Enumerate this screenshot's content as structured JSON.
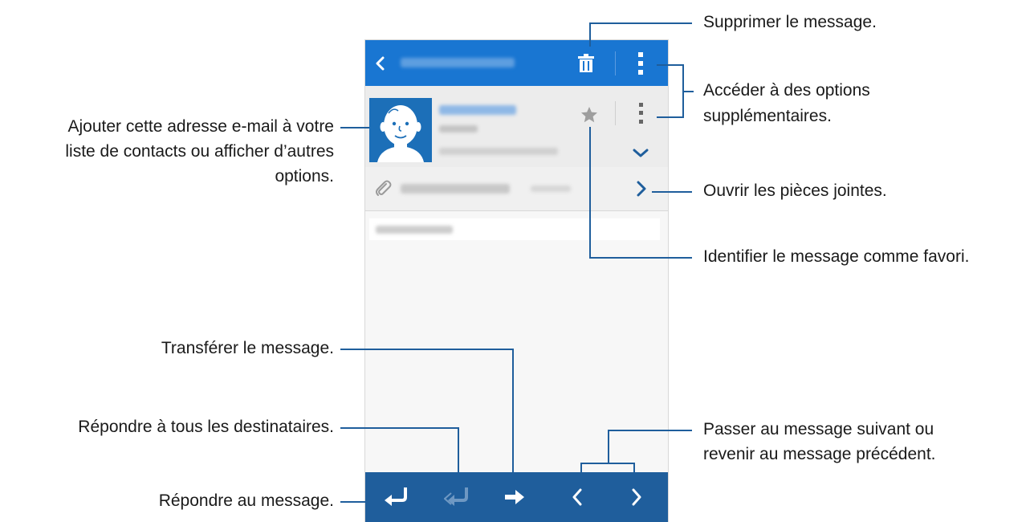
{
  "callouts": {
    "delete": "Supprimer le message.",
    "more_options_1": "Accéder à des options",
    "more_options_2": "supplémentaires.",
    "contact_1": "Ajouter cette adresse e-mail à votre",
    "contact_2": "liste de contacts ou afficher d’autres",
    "contact_3": "options.",
    "attachments": "Ouvrir les pièces jointes.",
    "favorite": "Identifier le message comme favori.",
    "forward": "Transférer le message.",
    "reply_all": "Répondre à tous les destinataires.",
    "navigate_1": "Passer au message suivant ou",
    "navigate_2": "revenir au message précédent.",
    "reply": "Répondre au message."
  },
  "colors": {
    "top_bar": "#1976d2",
    "bottom_bar": "#1f5e9c",
    "leader_line": "#1f5e9c",
    "avatar_bg": "#1c6fb8"
  },
  "icons": [
    "back-icon",
    "trash-icon",
    "more-vert-icon",
    "avatar-icon",
    "star-icon",
    "chevron-down-icon",
    "paperclip-icon",
    "chevron-right-icon",
    "reply-icon",
    "reply-all-icon",
    "forward-icon",
    "previous-icon",
    "next-icon"
  ]
}
